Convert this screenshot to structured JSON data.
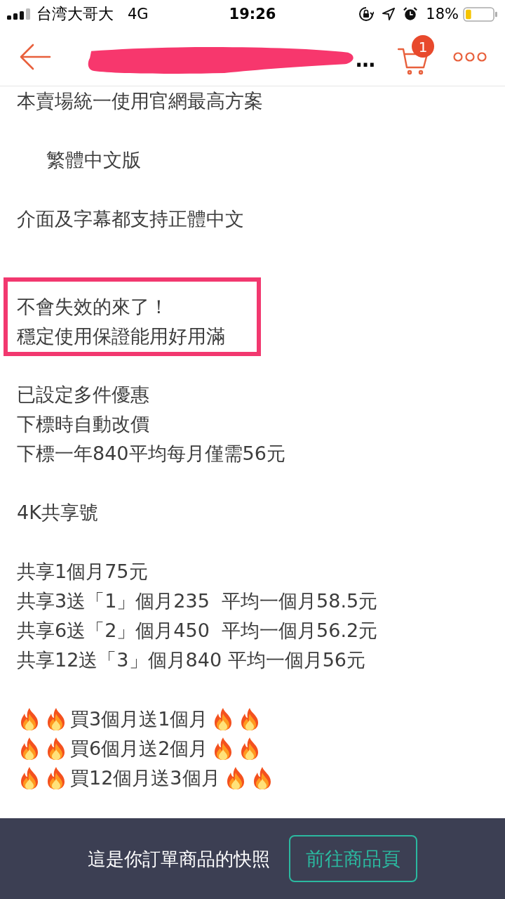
{
  "status_bar": {
    "carrier": "台湾大哥大",
    "network": "4G",
    "time": "19:26",
    "battery": "18%"
  },
  "header": {
    "title": "…",
    "redacted": true,
    "cart_badge": "1"
  },
  "description": {
    "blocks": [
      {
        "kind": "plain",
        "lines": [
          "本賣場統一使用官網最高方案"
        ]
      },
      {
        "kind": "indented",
        "lines": [
          "繁體中文版"
        ]
      },
      {
        "kind": "plain",
        "lines": [
          "介面及字幕都支持正體中文"
        ]
      },
      {
        "kind": "boxed",
        "lines": [
          "不會失效的來了！",
          "穩定使用保證能用好用滿"
        ]
      },
      {
        "kind": "plain",
        "lines": [
          "已設定多件優惠",
          "下標時自動改價",
          "下標一年840平均每月僅需56元"
        ]
      },
      {
        "kind": "plain",
        "lines": [
          "4K共享號"
        ]
      },
      {
        "kind": "plain",
        "lines": [
          "共享1個月75元",
          "共享3送「1」個月235  平均一個月58.5元",
          "共享6送「2」個月450  平均一個月56.2元",
          "共享12送「3」個月840 平均一個月56元"
        ]
      },
      {
        "kind": "promo",
        "lines": [
          "買3個月送1個月",
          "買6個月送2個月",
          "買12個月送3個月"
        ]
      }
    ]
  },
  "footer": {
    "notice": "這是你訂單商品的快照",
    "button": "前往商品頁"
  }
}
